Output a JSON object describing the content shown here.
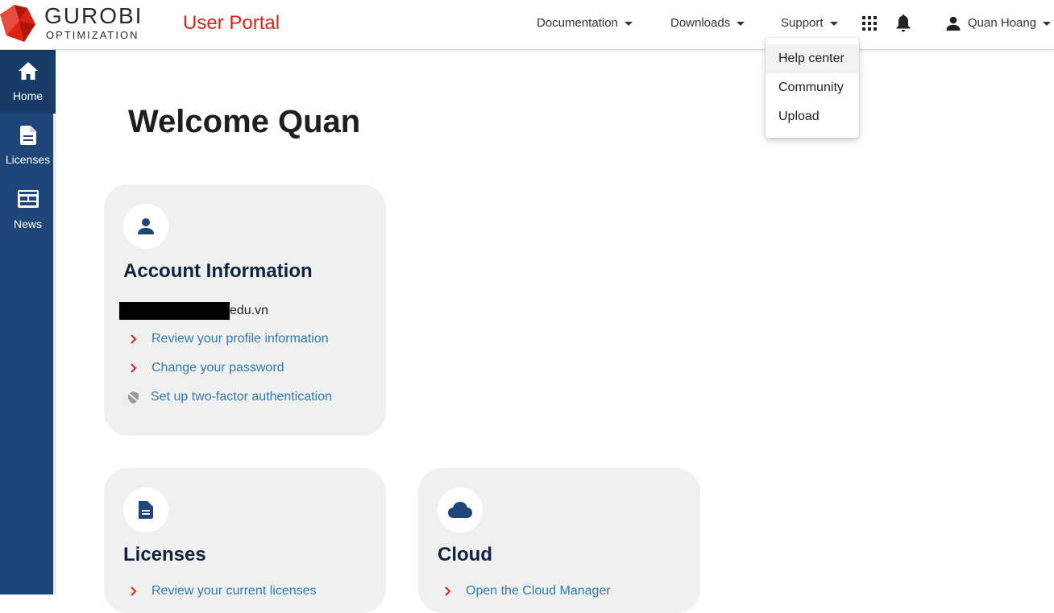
{
  "header": {
    "logo_word": "GUROBI",
    "logo_sub": "OPTIMIZATION",
    "portal_title": "User Portal",
    "nav": [
      {
        "label": "Documentation"
      },
      {
        "label": "Downloads"
      },
      {
        "label": "Support"
      }
    ],
    "user_name": "Quan Hoang",
    "icons": [
      "apps-grid-icon",
      "bell-icon",
      "person-icon",
      "caret-down-icon"
    ]
  },
  "support_menu": {
    "items": [
      {
        "label": "Help center"
      },
      {
        "label": "Community"
      },
      {
        "label": "Upload"
      }
    ]
  },
  "sidebar": {
    "items": [
      {
        "label": "Home",
        "icon": "home-icon",
        "active": true
      },
      {
        "label": "Licenses",
        "icon": "document-icon"
      },
      {
        "label": "News",
        "icon": "newspaper-icon"
      }
    ]
  },
  "main": {
    "welcome": "Welcome Quan",
    "account_card": {
      "title": "Account Information",
      "email_suffix": "edu.vn",
      "links": [
        {
          "label": "Review your profile information",
          "icon": "chevron-right-icon"
        },
        {
          "label": "Change your password",
          "icon": "chevron-right-icon"
        },
        {
          "label": "Set up two-factor authentication",
          "icon": "shield-off-icon"
        }
      ]
    },
    "licenses_card": {
      "title": "Licenses",
      "links": [
        {
          "label": "Review your current licenses"
        }
      ]
    },
    "cloud_card": {
      "title": "Cloud",
      "links": [
        {
          "label": "Open the Cloud Manager"
        }
      ]
    }
  },
  "colors": {
    "brand_red": "#dd2113",
    "sidebar_blue": "#1e4578",
    "link_blue": "#2e7bb5",
    "card_bg": "#f0f0f0",
    "title_navy": "#0f2340"
  }
}
